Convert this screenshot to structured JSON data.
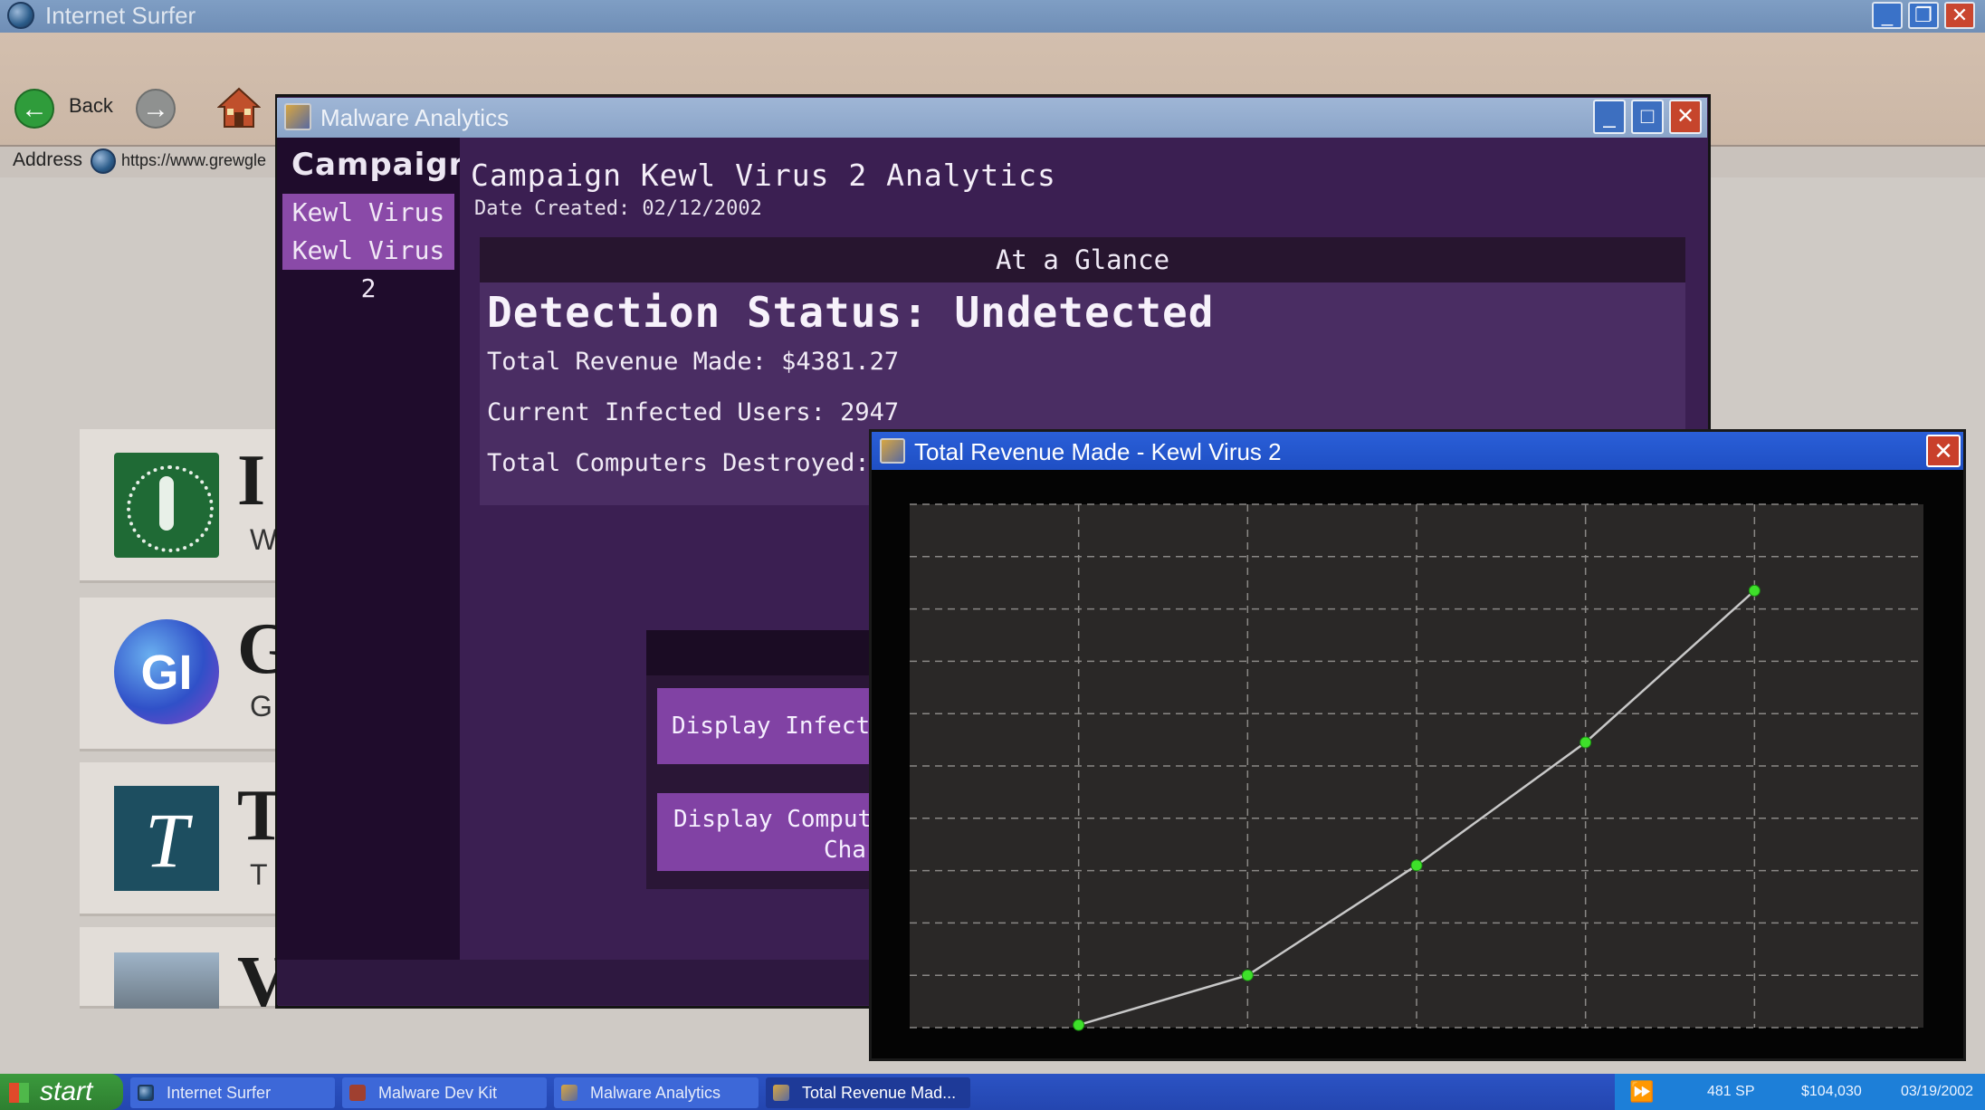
{
  "browser": {
    "title": "Internet Surfer",
    "back_label": "Back",
    "address_label": "Address",
    "address_value": "https://www.grewgle"
  },
  "search_results": [
    {
      "title": "I",
      "sub": "W"
    },
    {
      "title": "G",
      "sub": "G"
    },
    {
      "title": "T",
      "sub": "T"
    },
    {
      "title": "V",
      "sub": ""
    }
  ],
  "analytics": {
    "title": "Malware Analytics",
    "sidebar_heading": "Campaigns",
    "campaigns": [
      "Kewl Virus",
      "Kewl Virus 2"
    ],
    "main_title": "Campaign Kewl Virus 2 Analytics",
    "date_created": "Date Created: 02/12/2002",
    "glance_header": "At a Glance",
    "detection_status": "Detection Status: Undetected",
    "total_revenue": "Total Revenue Made: $4381.27",
    "infected_users": "Current Infected Users: 2947",
    "computers_destroyed": "Total Computers Destroyed:",
    "btn_infected": "Display Infecte",
    "btn_computers_line1": "Display Comput",
    "btn_computers_line2": "Cha"
  },
  "popup": {
    "title": "Total Revenue Made - Kewl Virus 2",
    "line_color": "#c8c8c8",
    "point_color": "#3ee02a"
  },
  "chart_data": {
    "type": "line",
    "title": "Total Revenue Made - Kewl Virus 2",
    "xlabel": "",
    "ylabel": "",
    "x": [
      1,
      2,
      3,
      4,
      5
    ],
    "xlim": [
      0,
      6
    ],
    "ylim": [
      0,
      10
    ],
    "series": [
      {
        "values": [
          0.05,
          1.0,
          3.1,
          5.45,
          8.35
        ]
      }
    ],
    "grid": true
  },
  "taskbar": {
    "start_label": "start",
    "items": [
      "Internet Surfer",
      "Malware Dev Kit",
      "Malware Analytics",
      "Total Revenue Mad..."
    ],
    "sp": "481 SP",
    "money": "$104,030",
    "date": "03/19/2002"
  }
}
